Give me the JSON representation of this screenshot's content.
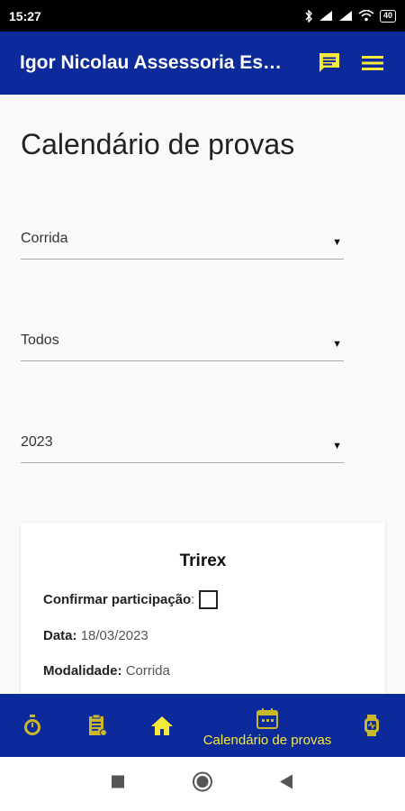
{
  "status_bar": {
    "time": "15:27",
    "battery": "40",
    "icons": [
      "bluetooth-icon",
      "signal-icon",
      "signal-icon",
      "wifi-icon",
      "battery-icon"
    ]
  },
  "app_bar": {
    "title": "Igor Nicolau Assessoria Esportiva",
    "icons": [
      "chat-icon",
      "menu-icon"
    ],
    "color": "#0d2a9a",
    "accent": "#f5e93a"
  },
  "page": {
    "title": "Calendário de provas"
  },
  "filters": {
    "sport": "Corrida",
    "category": "Todos",
    "year": "2023"
  },
  "event_card": {
    "title": "Trirex",
    "confirm_label": "Confirmar participação",
    "confirm_sep": ":",
    "confirmed": false,
    "date_label": "Data:",
    "date_value": "18/03/2023",
    "modality_label": "Modalidade:",
    "modality_value": "Corrida"
  },
  "bottom_nav": {
    "items": [
      {
        "icon": "stopwatch-icon"
      },
      {
        "icon": "clipboard-icon"
      },
      {
        "icon": "home-icon"
      },
      {
        "icon": "calendar-icon",
        "label": "Calendário de provas"
      },
      {
        "icon": "smartwatch-icon"
      }
    ]
  },
  "system_nav": {
    "icons": [
      "recents-icon",
      "home-circle-icon",
      "back-icon"
    ]
  }
}
